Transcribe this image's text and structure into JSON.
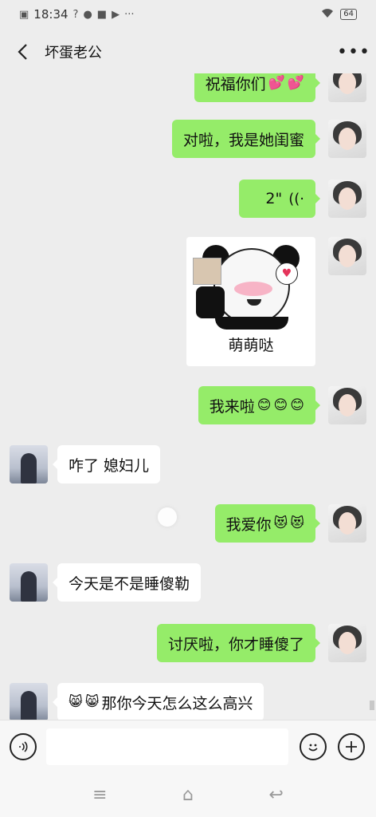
{
  "status_bar": {
    "time": "18:34",
    "battery": "64",
    "icons": [
      "sim-icon",
      "question-icon",
      "compass-icon",
      "video-icon",
      "camera-icon",
      "more-icon",
      "wifi-icon",
      "battery-icon"
    ]
  },
  "header": {
    "title": "坏蛋老公",
    "back_icon": "chevron-left-icon",
    "more_icon": "ellipsis-icon",
    "more_label": "•••"
  },
  "messages": [
    {
      "sender": "me",
      "type": "text",
      "text": "祝福你们",
      "emoji": [
        "💕",
        "💕"
      ]
    },
    {
      "sender": "me",
      "type": "text",
      "text": "对啦，我是她闺蜜"
    },
    {
      "sender": "me",
      "type": "voice",
      "duration": "2\"",
      "voice_icon": "((·"
    },
    {
      "sender": "me",
      "type": "sticker",
      "caption": "萌萌哒"
    },
    {
      "sender": "me",
      "type": "text",
      "text": "我来啦",
      "emoji": [
        "😊",
        "😊",
        "😊"
      ]
    },
    {
      "sender": "other",
      "type": "text",
      "text": "咋了  媳妇儿"
    },
    {
      "sender": "me",
      "type": "text",
      "text": "我爱你",
      "emoji": [
        "😻",
        "😻"
      ]
    },
    {
      "sender": "other",
      "type": "text",
      "text": "今天是不是睡傻勒"
    },
    {
      "sender": "me",
      "type": "text",
      "text": "讨厌啦，你才睡傻了"
    },
    {
      "sender": "other",
      "type": "text",
      "text": "那你今天怎么这么高兴",
      "emoji_prefix": [
        "😸",
        "😸"
      ]
    }
  ],
  "input_bar": {
    "value": "",
    "placeholder": "",
    "voice_icon": "voice-icon",
    "emoji_icon": "emoji-icon",
    "plus_icon": "plus-icon"
  },
  "nav_bar": {
    "menu_icon": "≡",
    "home_icon": "⌂",
    "back_icon": "↩"
  }
}
